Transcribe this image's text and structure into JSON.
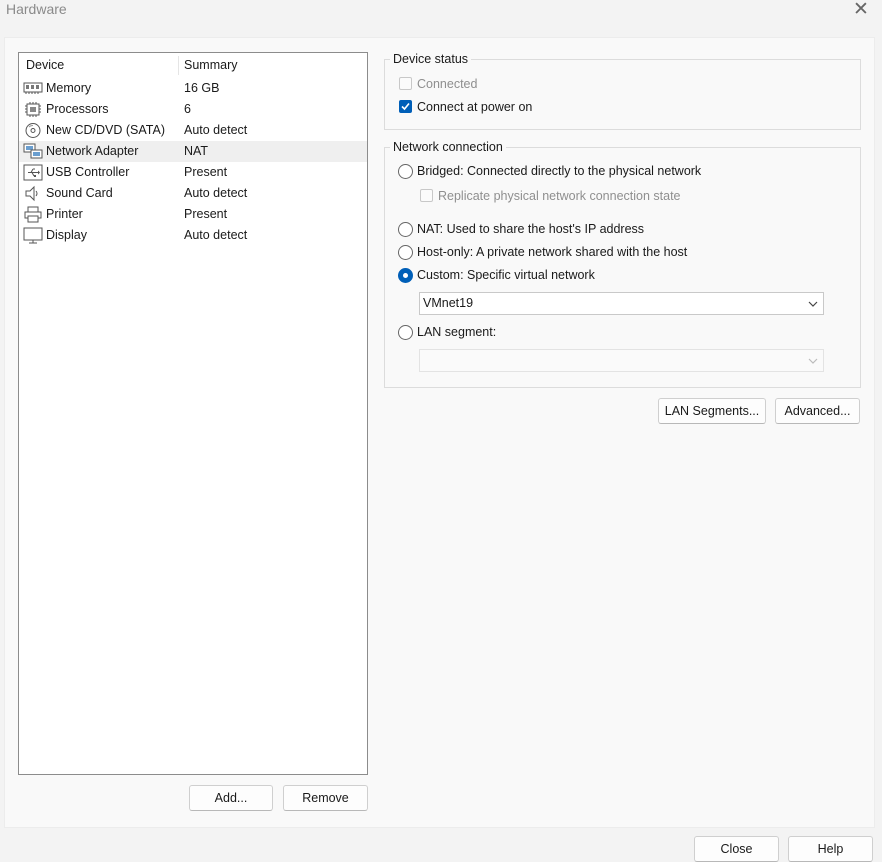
{
  "window": {
    "title": "Hardware",
    "close_glyph": "✕"
  },
  "device_list": {
    "col_device": "Device",
    "col_summary": "Summary",
    "rows": [
      {
        "name": "Memory",
        "summary": "16 GB",
        "icon": "memory-icon"
      },
      {
        "name": "Processors",
        "summary": "6",
        "icon": "processor-icon"
      },
      {
        "name": "New CD/DVD (SATA)",
        "summary": "Auto detect",
        "icon": "cd-dvd-icon"
      },
      {
        "name": "Network Adapter",
        "summary": "NAT",
        "icon": "network-adapter-icon",
        "selected": true
      },
      {
        "name": "USB Controller",
        "summary": "Present",
        "icon": "usb-icon"
      },
      {
        "name": "Sound Card",
        "summary": "Auto detect",
        "icon": "speaker-icon"
      },
      {
        "name": "Printer",
        "summary": "Present",
        "icon": "printer-icon"
      },
      {
        "name": "Display",
        "summary": "Auto detect",
        "icon": "monitor-icon"
      }
    ]
  },
  "buttons": {
    "add": "Add...",
    "remove": "Remove",
    "lan_segments": "LAN Segments...",
    "advanced": "Advanced...",
    "close": "Close",
    "help": "Help"
  },
  "device_status": {
    "title": "Device status",
    "connected": {
      "label": "Connected",
      "checked": false,
      "disabled": true
    },
    "connect_at_power_on": {
      "label": "Connect at power on",
      "checked": true
    }
  },
  "network_connection": {
    "title": "Network connection",
    "bridged": "Bridged: Connected directly to the physical network",
    "replicate": "Replicate physical network connection state",
    "nat": "NAT: Used to share the host's IP address",
    "host_only": "Host-only: A private network shared with the host",
    "custom": "Custom: Specific virtual network",
    "custom_network": "VMnet19",
    "lan_segment": "LAN segment:",
    "lan_segment_value": "",
    "selected": "custom"
  },
  "colors": {
    "accent": "#005fb8",
    "selected_row": "#efefef",
    "background": "#f3f3f3"
  }
}
